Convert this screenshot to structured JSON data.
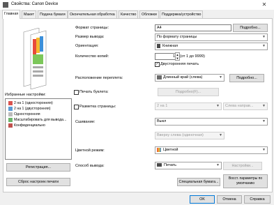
{
  "window": {
    "title": "Свойства: Canon Device",
    "close": "✕"
  },
  "tabs": [
    "Главная",
    "Макет",
    "Подача бумаги",
    "Окончательная обработка",
    "Качество",
    "Обложки",
    "Поддержка/устройство"
  ],
  "colors": {
    "accent": "#0078d7",
    "panel": "#ffffff"
  },
  "fields": {
    "page_size_label": "Формат страницы:",
    "page_size_value": "A4",
    "details_button": "Подробно...",
    "output_size_label": "Размер вывода:",
    "output_size_value": "По формату страницы",
    "orientation_label": "Ориентация:",
    "orientation_value": "Книжная",
    "copies_label": "Количество копий:",
    "copies_value": "1",
    "copies_range": "(от 1 до 9999)",
    "duplex_label": "Двусторонняя печать",
    "binding_label": "Расположение переплета:",
    "binding_value": "Длинный край (слева)",
    "binding_button": "Подробно...",
    "booklet_label": "Печать буклета:",
    "booklet_button": "Подробно(F)...",
    "layout_label": "Разметка страницы:",
    "layout_value": "2 на 1",
    "layout_order_value": "Слева направ...",
    "staple_label": "Сшивание:",
    "staple_value": "Выкл",
    "staple_position": "Вверху слева (одиночная)",
    "color_mode_label": "Цветной режим:",
    "color_mode_value": "Цветной",
    "output_method_label": "Способ вывода:",
    "output_method_value": "Печать",
    "settings_button": "Настройки..."
  },
  "favorites": {
    "label": "Избранные настройки:",
    "items": [
      "2 на 1 (односторонняя)",
      "2 на 1 (двусторонняя)",
      "Односторонняя",
      "Масштабировать для вывода...",
      "Конфиденциально"
    ],
    "register_button": "Регистрация..."
  },
  "bottom": {
    "reset_button": "Сброс настроек печати",
    "special_paper_button": "Специальная бумага...",
    "restore_defaults_button": "Восст. параметры по умолчанию",
    "ok_button": "OK",
    "cancel_button": "Отмена",
    "help_button": "Справка"
  }
}
